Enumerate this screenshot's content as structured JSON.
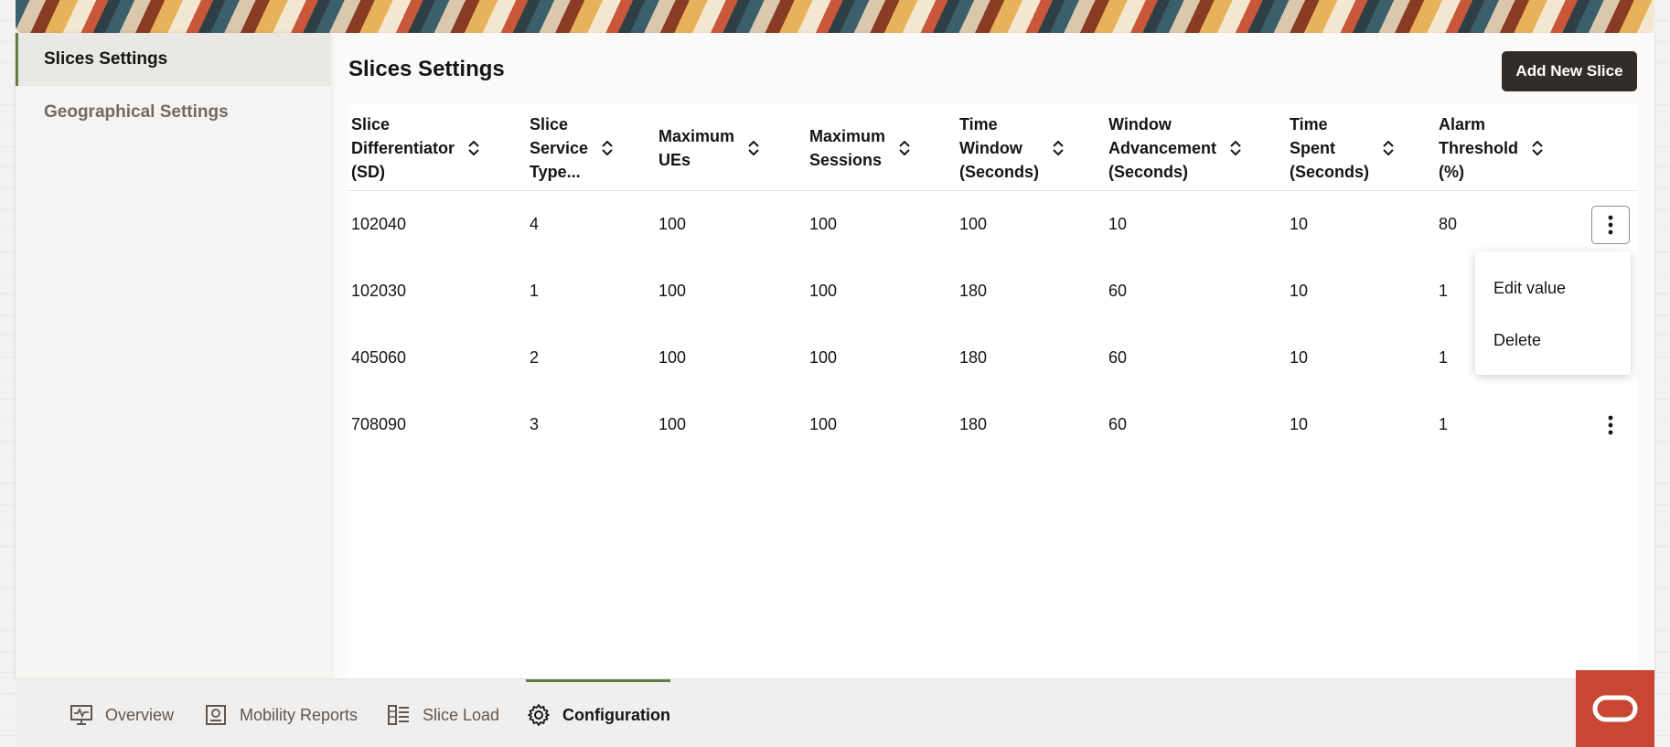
{
  "sidebar": {
    "items": [
      {
        "label": "Slices Settings",
        "active": true
      },
      {
        "label": "Geographical Settings",
        "active": false
      }
    ]
  },
  "main": {
    "title": "Slices Settings",
    "add_button_label": "Add New Slice"
  },
  "table": {
    "columns": [
      "Slice\nDifferentiator\n(SD)",
      "Slice\nService\nType...",
      "Maximum\nUEs",
      "Maximum\nSessions",
      "Time\nWindow\n(Seconds)",
      "Window\nAdvancement\n(Seconds)",
      "Time\nSpent\n(Seconds)",
      "Alarm\nThreshold\n(%)"
    ],
    "rows": [
      [
        "102040",
        "4",
        "100",
        "100",
        "100",
        "10",
        "10",
        "80"
      ],
      [
        "102030",
        "1",
        "100",
        "100",
        "180",
        "60",
        "10",
        "1"
      ],
      [
        "405060",
        "2",
        "100",
        "100",
        "180",
        "60",
        "10",
        "1"
      ],
      [
        "708090",
        "3",
        "100",
        "100",
        "180",
        "60",
        "10",
        "1"
      ]
    ],
    "row_actions_icon": "more-vertical-icon"
  },
  "context_menu": {
    "items": [
      "Edit value",
      "Delete"
    ]
  },
  "bottom_nav": {
    "tabs": [
      {
        "label": "Overview",
        "icon": "monitor-pulse-icon",
        "active": false
      },
      {
        "label": "Mobility Reports",
        "icon": "report-icon",
        "active": false
      },
      {
        "label": "Slice Load",
        "icon": "list-grid-icon",
        "active": false
      },
      {
        "label": "Configuration",
        "icon": "gear-icon",
        "active": true
      }
    ]
  },
  "brand": {
    "icon": "oracle-logo-icon",
    "color": "#c74634"
  },
  "colors": {
    "accent": "#5b7f45",
    "primary_button": "#312d2a"
  }
}
